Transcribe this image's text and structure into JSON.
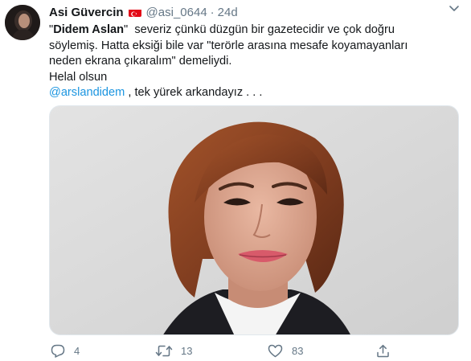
{
  "tweet": {
    "author": {
      "display_name": "Asi Güvercin",
      "flag_icon": "turkey-flag-icon",
      "handle": "@asi_0644",
      "separator": "·",
      "time": "24d"
    },
    "text": {
      "quote_open": "\"",
      "bold_name": "Didem Aslan",
      "quote_close": "\"",
      "line1_rest": "  severiz çünkü düzgün bir gazetecidir ve çok doğru",
      "line2": "söylemiş. Hatta eksiği bile var \"terörle arasına mesafe koyamayanları",
      "line3": "neden ekrana çıkaralım\" demeliydi.",
      "line4": "Helal olsun",
      "mention": "@arslandidem",
      "line5_rest": " , tek yürek arkandayız . . ."
    },
    "actions": {
      "reply_count": "4",
      "retweet_count": "13",
      "like_count": "83"
    },
    "colors": {
      "text": "#14171a",
      "secondary": "#657786",
      "link": "#1b95e0",
      "flag_red": "#e30a17"
    }
  }
}
